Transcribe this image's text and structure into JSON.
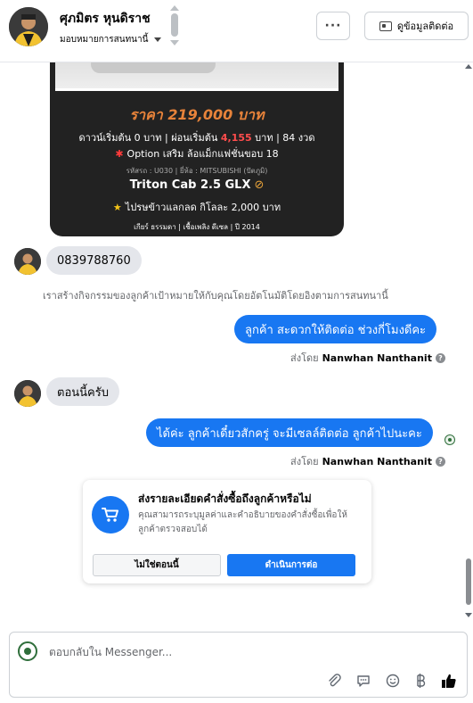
{
  "header": {
    "contact_name": "ศุภมิตร หุนดิราช",
    "assign_label": "มอบหมายการสนทนานี้",
    "more_label": "···",
    "view_contact_label": "ดูข้อมูลติดต่อ"
  },
  "product_card": {
    "price": "ราคา 219,000 บาท",
    "down_text_a": "ดาวน์เริ่มต้น 0 บาท | ผ่อนเริ่มต้น",
    "monthly": "4,155",
    "down_text_b": "บาท | 84 งวด",
    "option": "Option เสริม ล้อแม็กแฟชั่นขอบ 18",
    "code_text": "รหัสรถ : U030 | ยี่ห้อ : MITSUBISHI (ปัตภูมิ)",
    "model": "Triton Cab 2.5 GLX",
    "trade_in": "ไปรษข้าวแลกลด กิโลละ 2,000 บาท",
    "specs": "เกียร์ ธรรมดา | เชื้อเพลิง ดีเซล | ปี 2014"
  },
  "messages": [
    {
      "direction": "in",
      "text": "0839788760"
    },
    {
      "direction": "system",
      "text": "เราสร้างกิจกรรมของลูกค้าเป้าหมายให้กับคุณโดยอัตโนมัติโดยอิงตามการสนทนานี้"
    },
    {
      "direction": "out",
      "text": "ลูกค้า สะดวกให้ติดต่อ ช่วงกี่โมงดีคะ"
    },
    {
      "direction": "in",
      "text": "ตอนนี้ครับ"
    },
    {
      "direction": "out",
      "text": "ได้ค่ะ ลูกค้าเดี๋ยวสักครู่ จะมีเซลล์ติดต่อ ลูกค้าไปนะคะ"
    }
  ],
  "sent_by": {
    "prefix": "ส่งโดย",
    "name": "Nanwhan Nanthanit"
  },
  "order_prompt": {
    "title": "ส่งรายละเอียดคำสั่งซื้อถึงลูกค้าหรือไม่",
    "description": "คุณสามารถระบุมูลค่าและคำอธิบายของคำสั่งซื้อเพื่อให้ลูกค้าตรวจสอบได้",
    "decline_label": "ไม่ใช่ตอนนี้",
    "continue_label": "ดำเนินการต่อ"
  },
  "composer": {
    "placeholder": "ตอบกลับใน Messenger...",
    "tools": [
      "attach-icon",
      "saved-reply-icon",
      "emoji-icon",
      "baht-icon",
      "like-icon"
    ]
  },
  "colors": {
    "messenger_blue": "#1877f2",
    "card_dark": "#222222",
    "price_orange": "#e8833a"
  }
}
